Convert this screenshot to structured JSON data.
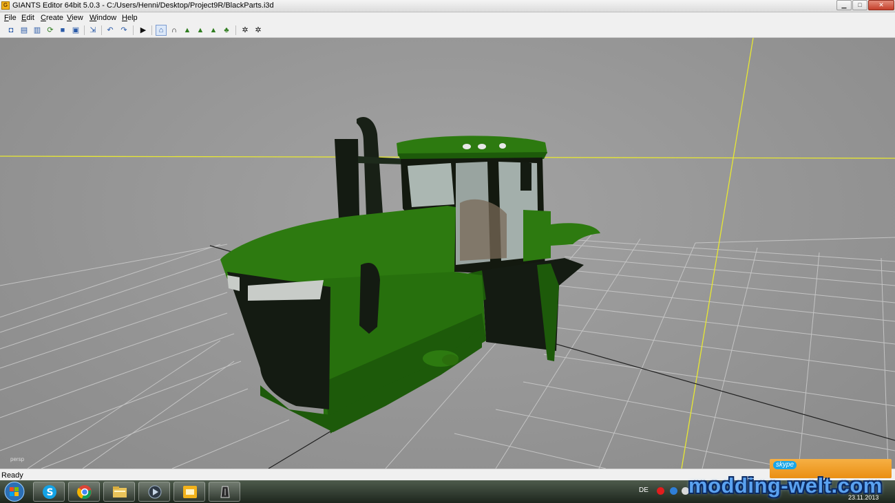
{
  "window": {
    "title": "GIANTS Editor 64bit 5.0.3 - C:/Users/Henni/Desktop/Project9R/BlackParts.i3d",
    "app_icon_icon": "giants-editor-icon",
    "controls": {
      "minimize": "minimize-icon",
      "maximize": "maximize-icon",
      "close": "close-icon"
    }
  },
  "menu": {
    "items": [
      {
        "label": "File"
      },
      {
        "label": "Edit"
      },
      {
        "label": "Create"
      },
      {
        "label": "View"
      },
      {
        "label": "Window"
      },
      {
        "label": "Help"
      }
    ]
  },
  "toolbar": {
    "buttons": [
      {
        "icon": "new-scene-icon",
        "glyph": "◘"
      },
      {
        "icon": "open-icon",
        "glyph": "▤"
      },
      {
        "icon": "open-recent-icon",
        "glyph": "▥"
      },
      {
        "icon": "reload-icon",
        "glyph": "⟳"
      },
      {
        "icon": "save-icon",
        "glyph": "■"
      },
      {
        "icon": "save-as-icon",
        "glyph": "▣"
      },
      {
        "icon": "import-icon",
        "glyph": "⇲"
      },
      {
        "icon": "undo-icon",
        "glyph": "↶"
      },
      {
        "icon": "redo-icon",
        "glyph": "↷"
      },
      {
        "icon": "play-icon",
        "glyph": "▶"
      },
      {
        "icon": "select-mode-icon",
        "glyph": "⌂",
        "pressed": true
      },
      {
        "icon": "magnet-icon",
        "glyph": "∩"
      },
      {
        "icon": "terrain-sculpt-icon",
        "glyph": "▲"
      },
      {
        "icon": "terrain-paint-icon",
        "glyph": "▲"
      },
      {
        "icon": "foliage-paint-icon",
        "glyph": "▲"
      },
      {
        "icon": "foliage-icon",
        "glyph": "♣"
      },
      {
        "icon": "render-settings-icon",
        "glyph": "✲"
      },
      {
        "icon": "shader-settings-icon",
        "glyph": "✲"
      }
    ]
  },
  "viewport": {
    "camera_label": "persp"
  },
  "statusbar": {
    "text": "Ready"
  },
  "notification": {
    "logo": "skype"
  },
  "taskbar": {
    "start_icon": "windows-start-icon",
    "apps": [
      "skype-icon",
      "chrome-icon",
      "file-explorer-icon",
      "media-player-icon",
      "giants-editor-icon",
      "pen-tool-icon"
    ],
    "language": "DE",
    "date": "23.11.2013"
  },
  "watermark": {
    "text": "modding-welt.com"
  },
  "colors": {
    "tractor_green": "#2d7a10",
    "tractor_dark_green": "#1d5a0a",
    "chassis_black": "#141b12",
    "viewport_grey": "#9a9a9a",
    "axis_yellow": "#e8e832",
    "skype_orange": "#f0a030"
  }
}
